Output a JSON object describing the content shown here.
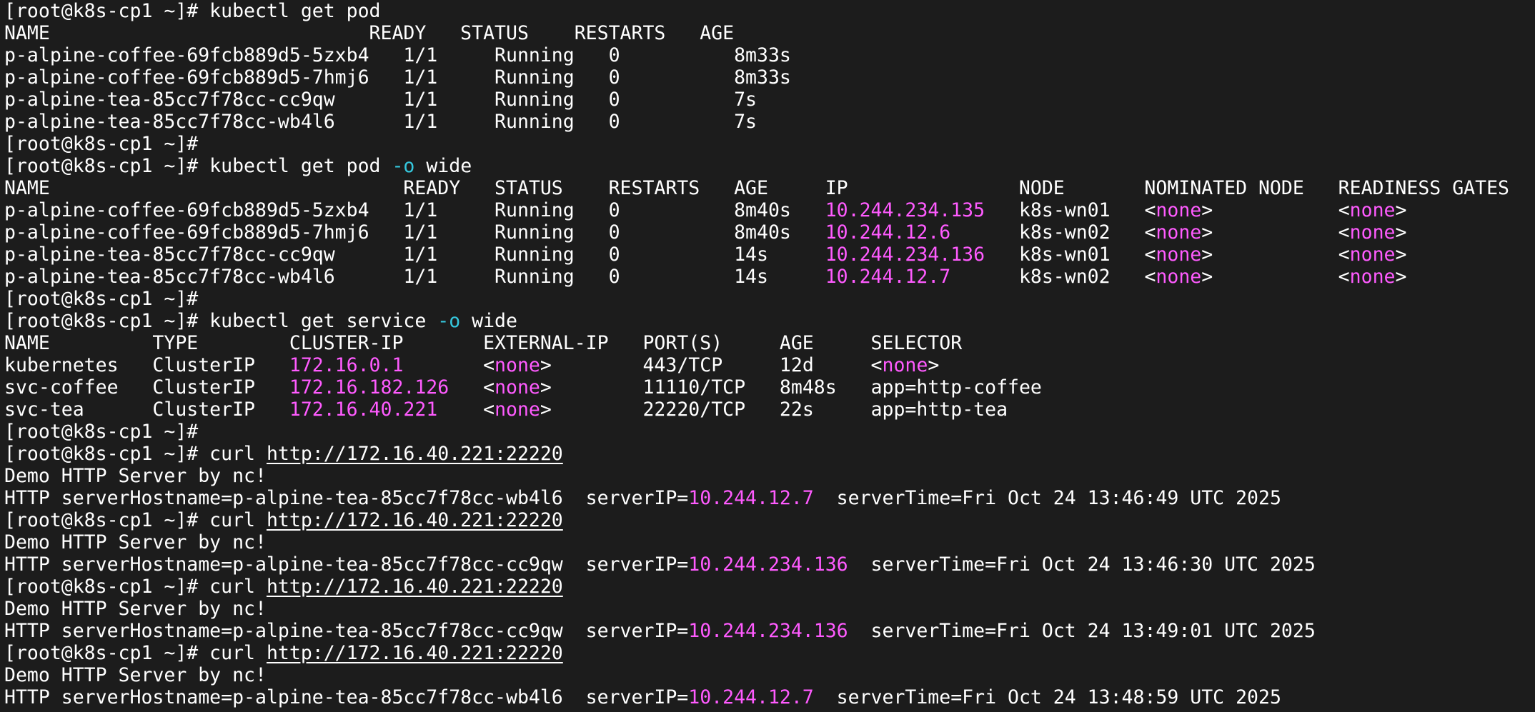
{
  "colors": {
    "background": "#1c1c1c",
    "text": "#ffffff",
    "magenta": "#ff5bff",
    "cyan": "#35c8de"
  },
  "terminal": {
    "lines": [
      [
        {
          "t": "[root@k8s-cp1 ~]# kubectl get pod"
        }
      ],
      [
        {
          "t": "NAME                            READY   STATUS    RESTARTS   AGE"
        }
      ],
      [
        {
          "t": "p-alpine-coffee-69fcb889d5-5zxb4   1/1     Running   0          8m33s"
        }
      ],
      [
        {
          "t": "p-alpine-coffee-69fcb889d5-7hmj6   1/1     Running   0          8m33s"
        }
      ],
      [
        {
          "t": "p-alpine-tea-85cc7f78cc-cc9qw      1/1     Running   0          7s"
        }
      ],
      [
        {
          "t": "p-alpine-tea-85cc7f78cc-wb4l6      1/1     Running   0          7s"
        }
      ],
      [
        {
          "t": "[root@k8s-cp1 ~]#"
        }
      ],
      [
        {
          "t": "[root@k8s-cp1 ~]# kubectl get pod "
        },
        {
          "t": "-o",
          "c": "cyan"
        },
        {
          "t": " wide"
        }
      ],
      [
        {
          "t": "NAME                               READY   STATUS    RESTARTS   AGE     IP               NODE       NOMINATED NODE   READINESS GATES"
        }
      ],
      [
        {
          "t": "p-alpine-coffee-69fcb889d5-5zxb4   1/1     Running   0          8m40s   "
        },
        {
          "t": "10.244.234.135",
          "c": "magenta"
        },
        {
          "t": "   k8s-wn01   <"
        },
        {
          "t": "none",
          "c": "magenta"
        },
        {
          "t": ">           <"
        },
        {
          "t": "none",
          "c": "magenta"
        },
        {
          "t": ">"
        }
      ],
      [
        {
          "t": "p-alpine-coffee-69fcb889d5-7hmj6   1/1     Running   0          8m40s   "
        },
        {
          "t": "10.244.12.6",
          "c": "magenta"
        },
        {
          "t": "      k8s-wn02   <"
        },
        {
          "t": "none",
          "c": "magenta"
        },
        {
          "t": ">           <"
        },
        {
          "t": "none",
          "c": "magenta"
        },
        {
          "t": ">"
        }
      ],
      [
        {
          "t": "p-alpine-tea-85cc7f78cc-cc9qw      1/1     Running   0          14s     "
        },
        {
          "t": "10.244.234.136",
          "c": "magenta"
        },
        {
          "t": "   k8s-wn01   <"
        },
        {
          "t": "none",
          "c": "magenta"
        },
        {
          "t": ">           <"
        },
        {
          "t": "none",
          "c": "magenta"
        },
        {
          "t": ">"
        }
      ],
      [
        {
          "t": "p-alpine-tea-85cc7f78cc-wb4l6      1/1     Running   0          14s     "
        },
        {
          "t": "10.244.12.7",
          "c": "magenta"
        },
        {
          "t": "      k8s-wn02   <"
        },
        {
          "t": "none",
          "c": "magenta"
        },
        {
          "t": ">           <"
        },
        {
          "t": "none",
          "c": "magenta"
        },
        {
          "t": ">"
        }
      ],
      [
        {
          "t": "[root@k8s-cp1 ~]#"
        }
      ],
      [
        {
          "t": "[root@k8s-cp1 ~]# kubectl get service "
        },
        {
          "t": "-o",
          "c": "cyan"
        },
        {
          "t": " wide"
        }
      ],
      [
        {
          "t": "NAME         TYPE        CLUSTER-IP       EXTERNAL-IP   PORT(S)     AGE     SELECTOR"
        }
      ],
      [
        {
          "t": "kubernetes   ClusterIP   "
        },
        {
          "t": "172.16.0.1",
          "c": "magenta"
        },
        {
          "t": "       <"
        },
        {
          "t": "none",
          "c": "magenta"
        },
        {
          "t": ">        443/TCP     12d     <"
        },
        {
          "t": "none",
          "c": "magenta"
        },
        {
          "t": ">"
        }
      ],
      [
        {
          "t": "svc-coffee   ClusterIP   "
        },
        {
          "t": "172.16.182.126",
          "c": "magenta"
        },
        {
          "t": "   <"
        },
        {
          "t": "none",
          "c": "magenta"
        },
        {
          "t": ">        11110/TCP   8m48s   app=http-coffee"
        }
      ],
      [
        {
          "t": "svc-tea      ClusterIP   "
        },
        {
          "t": "172.16.40.221",
          "c": "magenta"
        },
        {
          "t": "    <"
        },
        {
          "t": "none",
          "c": "magenta"
        },
        {
          "t": ">        22220/TCP   22s     app=http-tea"
        }
      ],
      [
        {
          "t": "[root@k8s-cp1 ~]#"
        }
      ],
      [
        {
          "t": "[root@k8s-cp1 ~]# curl "
        },
        {
          "t": "http://172.16.40.221:22220",
          "link": true
        }
      ],
      [
        {
          "t": "Demo HTTP Server by nc!"
        }
      ],
      [
        {
          "t": "HTTP serverHostname=p-alpine-tea-85cc7f78cc-wb4l6  serverIP="
        },
        {
          "t": "10.244.12.7",
          "c": "magenta"
        },
        {
          "t": "  serverTime=Fri Oct 24 13:46:49 UTC 2025"
        }
      ],
      [
        {
          "t": "[root@k8s-cp1 ~]# curl "
        },
        {
          "t": "http://172.16.40.221:22220",
          "link": true
        }
      ],
      [
        {
          "t": "Demo HTTP Server by nc!"
        }
      ],
      [
        {
          "t": "HTTP serverHostname=p-alpine-tea-85cc7f78cc-cc9qw  serverIP="
        },
        {
          "t": "10.244.234.136",
          "c": "magenta"
        },
        {
          "t": "  serverTime=Fri Oct 24 13:46:30 UTC 2025"
        }
      ],
      [
        {
          "t": "[root@k8s-cp1 ~]# curl "
        },
        {
          "t": "http://172.16.40.221:22220",
          "link": true
        }
      ],
      [
        {
          "t": "Demo HTTP Server by nc!"
        }
      ],
      [
        {
          "t": "HTTP serverHostname=p-alpine-tea-85cc7f78cc-cc9qw  serverIP="
        },
        {
          "t": "10.244.234.136",
          "c": "magenta"
        },
        {
          "t": "  serverTime=Fri Oct 24 13:49:01 UTC 2025"
        }
      ],
      [
        {
          "t": "[root@k8s-cp1 ~]# curl "
        },
        {
          "t": "http://172.16.40.221:22220",
          "link": true
        }
      ],
      [
        {
          "t": "Demo HTTP Server by nc!"
        }
      ],
      [
        {
          "t": "HTTP serverHostname=p-alpine-tea-85cc7f78cc-wb4l6  serverIP="
        },
        {
          "t": "10.244.12.7",
          "c": "magenta"
        },
        {
          "t": "  serverTime=Fri Oct 24 13:48:59 UTC 2025"
        }
      ]
    ]
  }
}
